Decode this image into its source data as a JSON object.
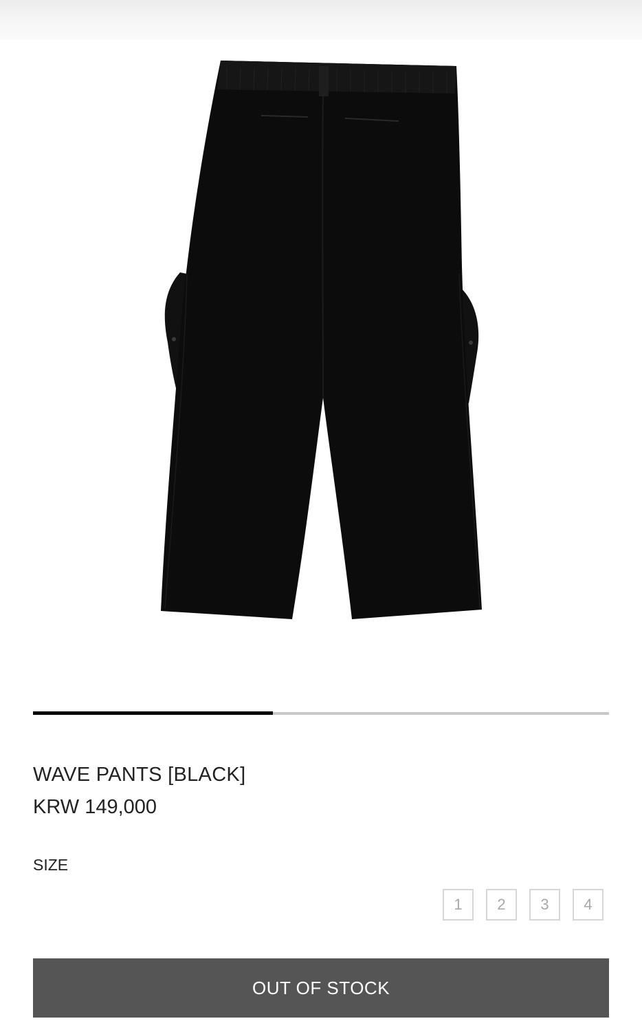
{
  "product": {
    "image_icon": "black-wave-pants-back-view",
    "image_gallery_progress": 0.417,
    "name": "WAVE PANTS [BLACK]",
    "price": "KRW 149,000"
  },
  "size_selector": {
    "label": "SIZE",
    "options": [
      "1",
      "2",
      "3",
      "4"
    ]
  },
  "cta": {
    "label": "OUT OF STOCK"
  },
  "colors": {
    "garment": "#0c0c0c",
    "button_bg": "#555555",
    "progress_active": "#000000",
    "progress_track": "#c8c8c8"
  }
}
